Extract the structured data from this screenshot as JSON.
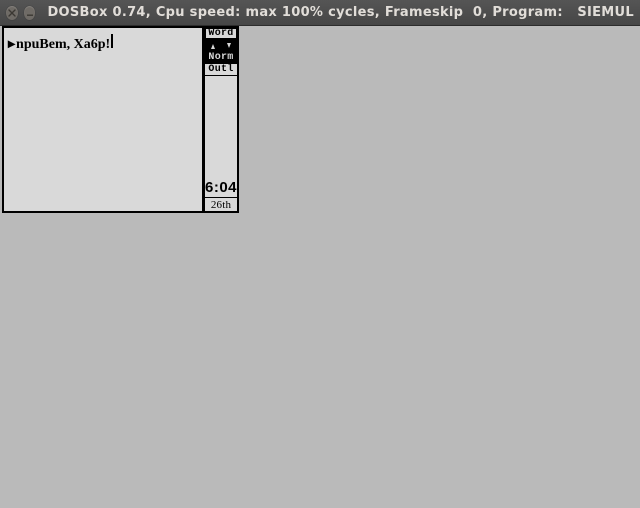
{
  "titlebar": {
    "title": "DOSBox 0.74, Cpu speed: max 100% cycles, Frameskip  0, Program:   SIEMUL"
  },
  "editor": {
    "prompt_symbol": "▸",
    "text": "npuBem, Xa6p!"
  },
  "status": {
    "mode": "Word",
    "style": "Norm",
    "outline": "Outl",
    "time": "6:04",
    "date": "26th"
  }
}
